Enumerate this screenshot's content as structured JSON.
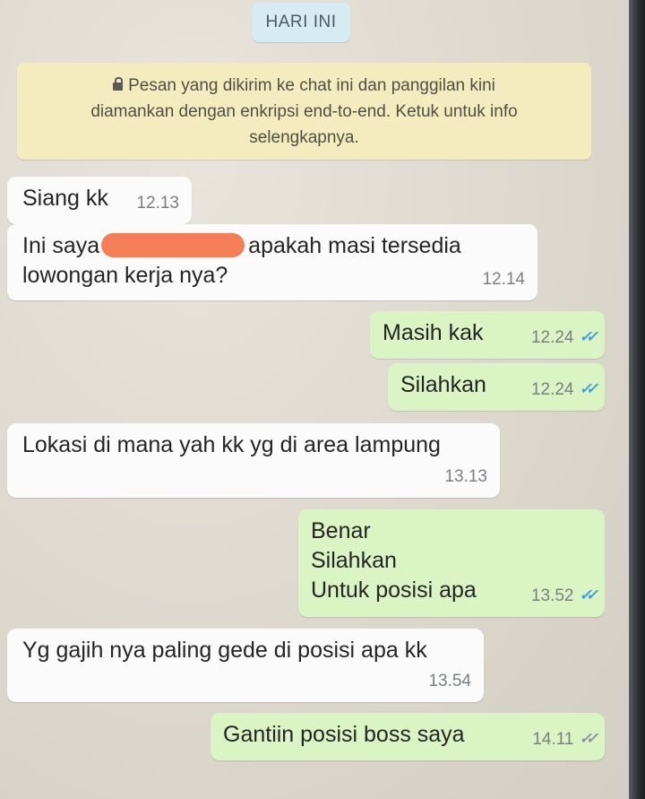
{
  "chat": {
    "date_chip": "HARI INI",
    "encryption_notice": {
      "lines": [
        "Pesan yang dikirim ke chat ini dan panggilan kini",
        "diamankan dengan enkripsi end-to-end. Ketuk untuk info",
        "selengkapnya."
      ]
    },
    "messages": [
      {
        "direction": "incoming",
        "text": "Siang kk",
        "time": "12.13"
      },
      {
        "direction": "incoming",
        "lines": [
          "Ini saya",
          "apakah masi tersedia",
          "lowongan kerja nya?"
        ],
        "time": "12.14",
        "redacted_name": true
      },
      {
        "direction": "outgoing",
        "text": "Masih kak",
        "time": "12.24",
        "status": "read"
      },
      {
        "direction": "outgoing",
        "text": "Silahkan",
        "time": "12.24",
        "status": "read"
      },
      {
        "direction": "incoming",
        "text": "Lokasi di mana yah kk yg di area lampung",
        "time": "13.13"
      },
      {
        "direction": "outgoing",
        "lines": [
          "Benar",
          "Silahkan",
          "Untuk posisi apa"
        ],
        "time": "13.52",
        "status": "read"
      },
      {
        "direction": "incoming",
        "text": "Yg gajih nya paling gede di posisi apa kk",
        "time": "13.54"
      },
      {
        "direction": "outgoing",
        "text": "Gantiin posisi boss saya",
        "time": "14.11",
        "status": "delivered"
      }
    ]
  },
  "colors": {
    "incoming_bubble": "#fbfbfb",
    "outgoing_bubble": "#dbf4c4",
    "notice_bg": "#f4ecbf",
    "date_chip_bg": "#d6ecf2",
    "read_ticks": "#3f9fd6",
    "redaction": "#f47e55"
  },
  "icons": {
    "lock": "lock-icon",
    "read_receipt": "double-check-icon"
  }
}
